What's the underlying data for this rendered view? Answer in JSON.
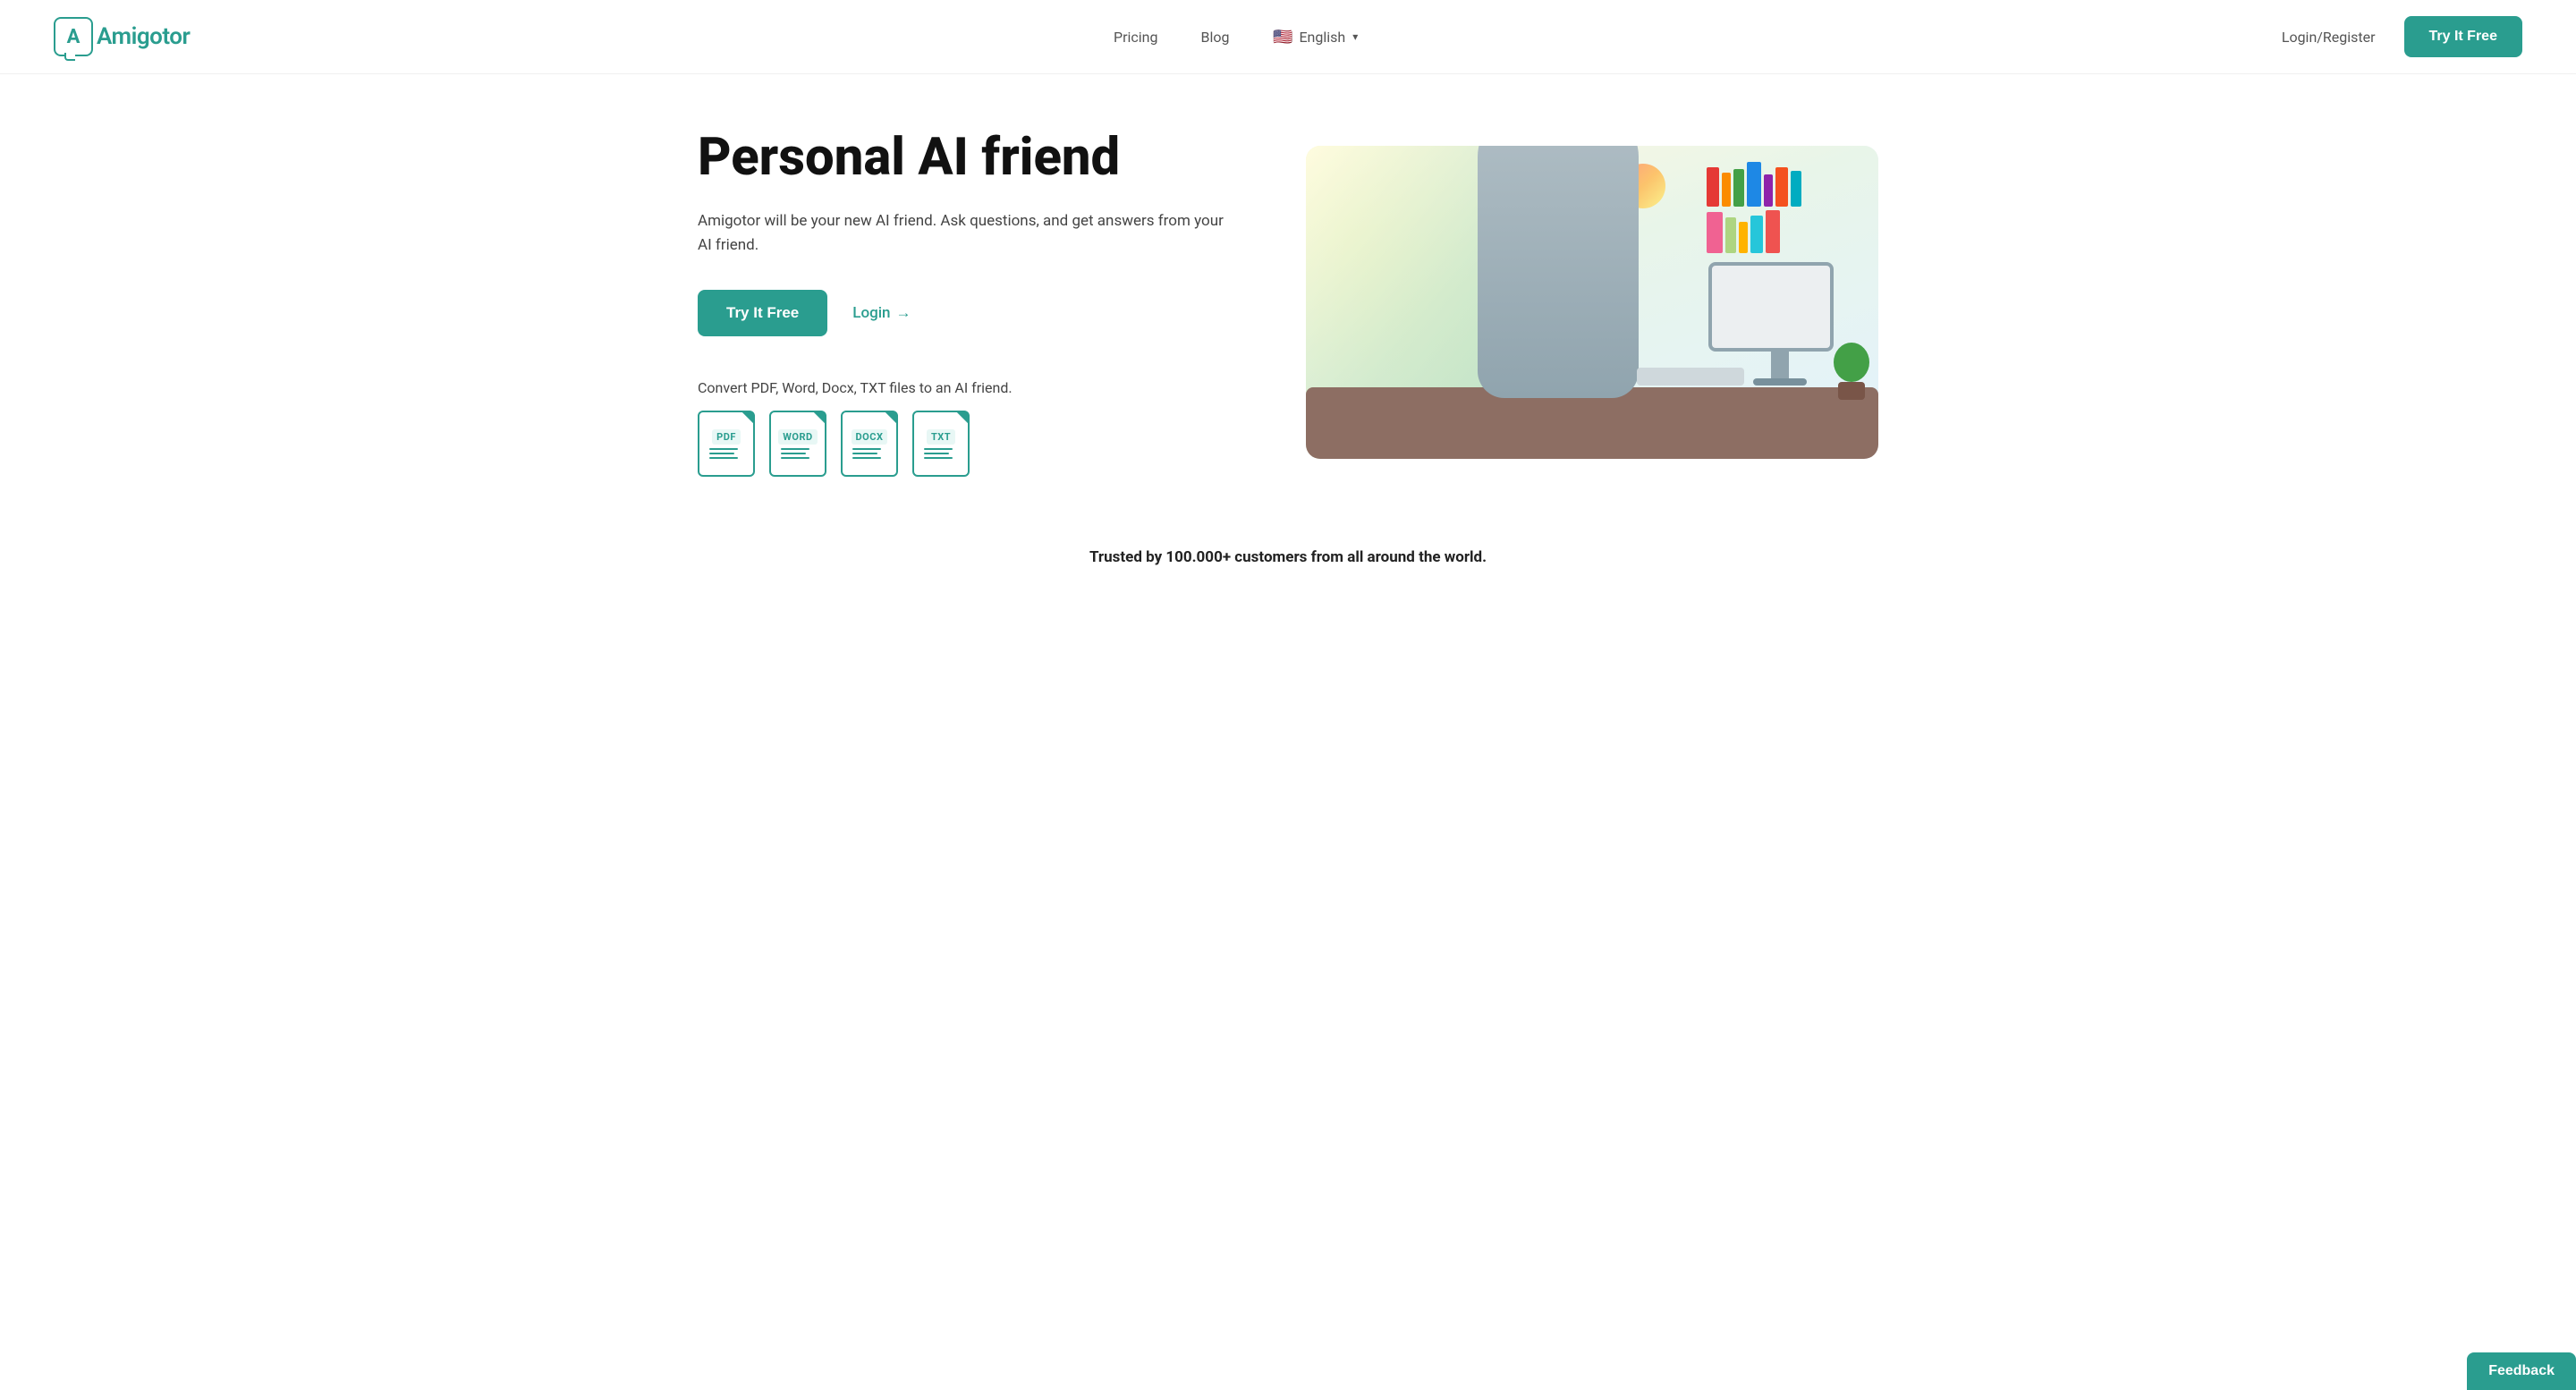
{
  "brand": {
    "name": "Amigotor",
    "logo_letter": "A"
  },
  "nav": {
    "pricing_label": "Pricing",
    "blog_label": "Blog",
    "language_label": "English",
    "language_flag": "🇺🇸",
    "login_register_label": "Login/Register",
    "try_it_free_label": "Try It Free"
  },
  "hero": {
    "title": "Personal AI friend",
    "description": "Amigotor will be your new AI friend. Ask questions, and get answers from your AI friend.",
    "try_button_label": "Try It Free",
    "login_label": "Login",
    "login_arrow": "→",
    "convert_text": "Convert PDF, Word, Docx, TXT files to an AI friend.",
    "file_types": [
      "PDF",
      "WORD",
      "DOCX",
      "TXT"
    ]
  },
  "trusted": {
    "text": "Trusted by 100.000+ customers from all around the world."
  },
  "feedback": {
    "label": "Feedback"
  }
}
